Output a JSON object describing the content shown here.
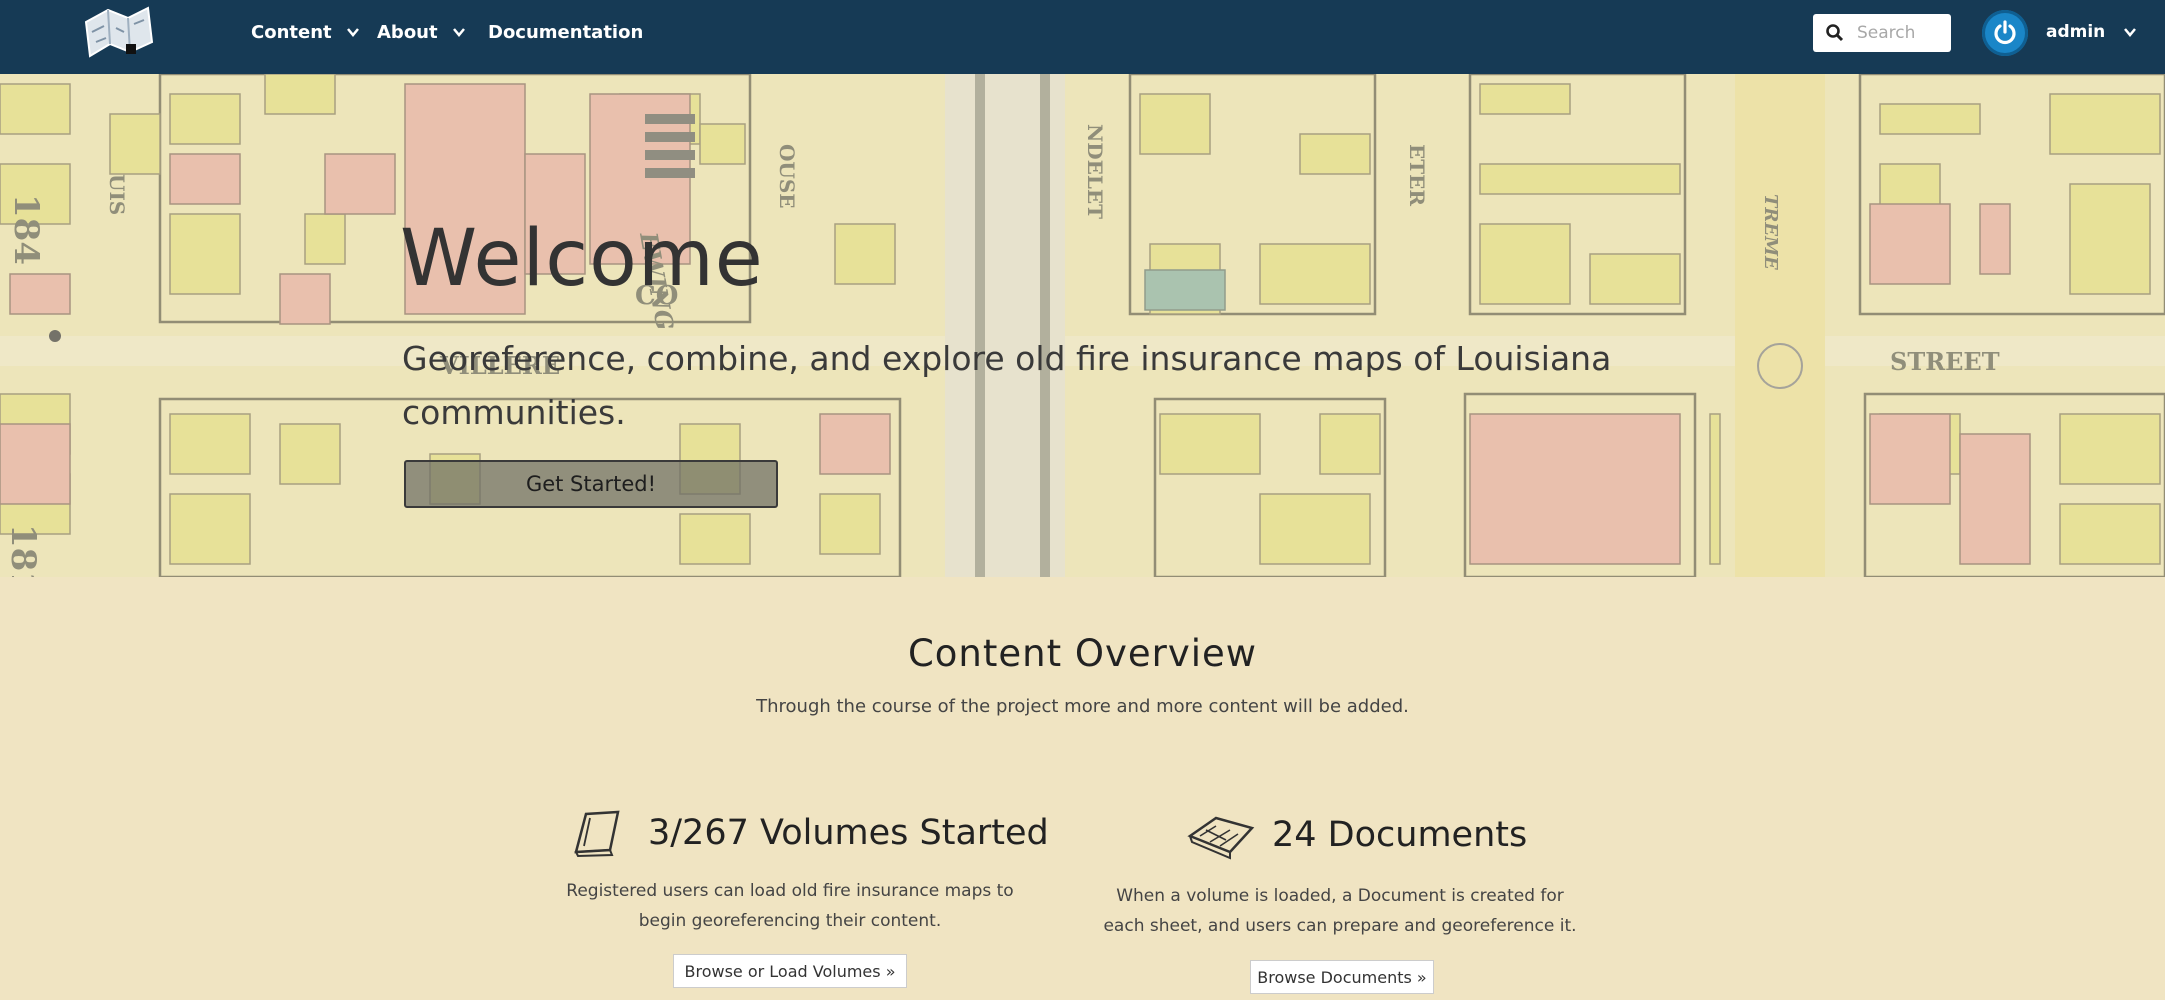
{
  "navbar": {
    "menu": [
      {
        "label": "Content",
        "has_dropdown": true
      },
      {
        "label": "About",
        "has_dropdown": true
      },
      {
        "label": "Documentation",
        "has_dropdown": false
      }
    ],
    "search_placeholder": "Search",
    "user_label": "admin",
    "colors": {
      "background": "#163a55",
      "power_icon": "#1a86c8"
    }
  },
  "hero": {
    "title": "Welcome",
    "subtitle": "Georeference, combine, and explore old fire insurance maps of Louisiana communities.",
    "button_label": "Get Started!"
  },
  "overview": {
    "title": "Content Overview",
    "subtitle": "Through the course of the project more and more content will be added.",
    "cards": [
      {
        "icon": "book-icon",
        "heading": "3/267 Volumes Started",
        "description": [
          "Registered users can load old fire insurance maps to",
          "begin georeferencing their content."
        ],
        "button_label": "Browse or Load Volumes »"
      },
      {
        "icon": "map-sheet-icon",
        "heading": "24 Documents",
        "description": [
          "When a volume is loaded, a Document is created for",
          "each sheet, and users can prepare and georeference it."
        ],
        "button_label": "Browse Documents »"
      }
    ]
  },
  "background": {
    "page": "#f0e4c2",
    "map_yellow": "#e6e08a",
    "map_pink": "#e8b1a4"
  }
}
